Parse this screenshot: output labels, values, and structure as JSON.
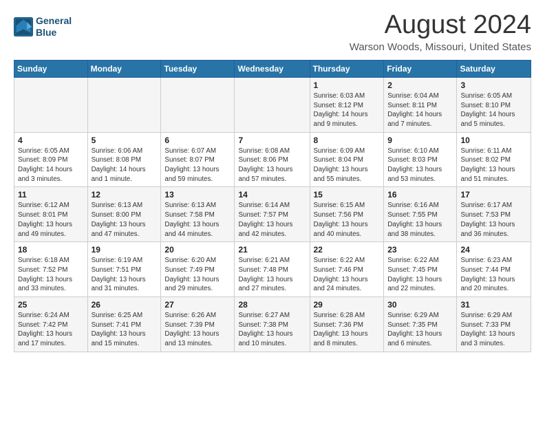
{
  "header": {
    "logo_line1": "General",
    "logo_line2": "Blue",
    "title": "August 2024",
    "subtitle": "Warson Woods, Missouri, United States"
  },
  "days_of_week": [
    "Sunday",
    "Monday",
    "Tuesday",
    "Wednesday",
    "Thursday",
    "Friday",
    "Saturday"
  ],
  "weeks": [
    [
      {
        "day": "",
        "info": ""
      },
      {
        "day": "",
        "info": ""
      },
      {
        "day": "",
        "info": ""
      },
      {
        "day": "",
        "info": ""
      },
      {
        "day": "1",
        "info": "Sunrise: 6:03 AM\nSunset: 8:12 PM\nDaylight: 14 hours\nand 9 minutes."
      },
      {
        "day": "2",
        "info": "Sunrise: 6:04 AM\nSunset: 8:11 PM\nDaylight: 14 hours\nand 7 minutes."
      },
      {
        "day": "3",
        "info": "Sunrise: 6:05 AM\nSunset: 8:10 PM\nDaylight: 14 hours\nand 5 minutes."
      }
    ],
    [
      {
        "day": "4",
        "info": "Sunrise: 6:05 AM\nSunset: 8:09 PM\nDaylight: 14 hours\nand 3 minutes."
      },
      {
        "day": "5",
        "info": "Sunrise: 6:06 AM\nSunset: 8:08 PM\nDaylight: 14 hours\nand 1 minute."
      },
      {
        "day": "6",
        "info": "Sunrise: 6:07 AM\nSunset: 8:07 PM\nDaylight: 13 hours\nand 59 minutes."
      },
      {
        "day": "7",
        "info": "Sunrise: 6:08 AM\nSunset: 8:06 PM\nDaylight: 13 hours\nand 57 minutes."
      },
      {
        "day": "8",
        "info": "Sunrise: 6:09 AM\nSunset: 8:04 PM\nDaylight: 13 hours\nand 55 minutes."
      },
      {
        "day": "9",
        "info": "Sunrise: 6:10 AM\nSunset: 8:03 PM\nDaylight: 13 hours\nand 53 minutes."
      },
      {
        "day": "10",
        "info": "Sunrise: 6:11 AM\nSunset: 8:02 PM\nDaylight: 13 hours\nand 51 minutes."
      }
    ],
    [
      {
        "day": "11",
        "info": "Sunrise: 6:12 AM\nSunset: 8:01 PM\nDaylight: 13 hours\nand 49 minutes."
      },
      {
        "day": "12",
        "info": "Sunrise: 6:13 AM\nSunset: 8:00 PM\nDaylight: 13 hours\nand 47 minutes."
      },
      {
        "day": "13",
        "info": "Sunrise: 6:13 AM\nSunset: 7:58 PM\nDaylight: 13 hours\nand 44 minutes."
      },
      {
        "day": "14",
        "info": "Sunrise: 6:14 AM\nSunset: 7:57 PM\nDaylight: 13 hours\nand 42 minutes."
      },
      {
        "day": "15",
        "info": "Sunrise: 6:15 AM\nSunset: 7:56 PM\nDaylight: 13 hours\nand 40 minutes."
      },
      {
        "day": "16",
        "info": "Sunrise: 6:16 AM\nSunset: 7:55 PM\nDaylight: 13 hours\nand 38 minutes."
      },
      {
        "day": "17",
        "info": "Sunrise: 6:17 AM\nSunset: 7:53 PM\nDaylight: 13 hours\nand 36 minutes."
      }
    ],
    [
      {
        "day": "18",
        "info": "Sunrise: 6:18 AM\nSunset: 7:52 PM\nDaylight: 13 hours\nand 33 minutes."
      },
      {
        "day": "19",
        "info": "Sunrise: 6:19 AM\nSunset: 7:51 PM\nDaylight: 13 hours\nand 31 minutes."
      },
      {
        "day": "20",
        "info": "Sunrise: 6:20 AM\nSunset: 7:49 PM\nDaylight: 13 hours\nand 29 minutes."
      },
      {
        "day": "21",
        "info": "Sunrise: 6:21 AM\nSunset: 7:48 PM\nDaylight: 13 hours\nand 27 minutes."
      },
      {
        "day": "22",
        "info": "Sunrise: 6:22 AM\nSunset: 7:46 PM\nDaylight: 13 hours\nand 24 minutes."
      },
      {
        "day": "23",
        "info": "Sunrise: 6:22 AM\nSunset: 7:45 PM\nDaylight: 13 hours\nand 22 minutes."
      },
      {
        "day": "24",
        "info": "Sunrise: 6:23 AM\nSunset: 7:44 PM\nDaylight: 13 hours\nand 20 minutes."
      }
    ],
    [
      {
        "day": "25",
        "info": "Sunrise: 6:24 AM\nSunset: 7:42 PM\nDaylight: 13 hours\nand 17 minutes."
      },
      {
        "day": "26",
        "info": "Sunrise: 6:25 AM\nSunset: 7:41 PM\nDaylight: 13 hours\nand 15 minutes."
      },
      {
        "day": "27",
        "info": "Sunrise: 6:26 AM\nSunset: 7:39 PM\nDaylight: 13 hours\nand 13 minutes."
      },
      {
        "day": "28",
        "info": "Sunrise: 6:27 AM\nSunset: 7:38 PM\nDaylight: 13 hours\nand 10 minutes."
      },
      {
        "day": "29",
        "info": "Sunrise: 6:28 AM\nSunset: 7:36 PM\nDaylight: 13 hours\nand 8 minutes."
      },
      {
        "day": "30",
        "info": "Sunrise: 6:29 AM\nSunset: 7:35 PM\nDaylight: 13 hours\nand 6 minutes."
      },
      {
        "day": "31",
        "info": "Sunrise: 6:29 AM\nSunset: 7:33 PM\nDaylight: 13 hours\nand 3 minutes."
      }
    ]
  ]
}
